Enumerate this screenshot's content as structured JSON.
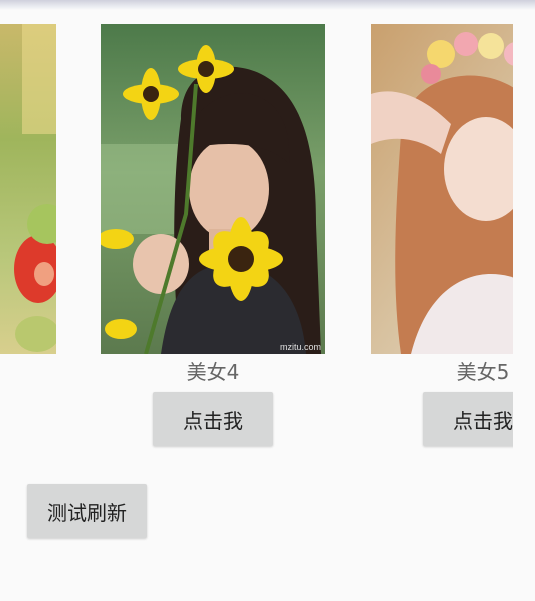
{
  "carousel": {
    "items": [
      {
        "caption": "",
        "button_label": ""
      },
      {
        "caption": "美女4",
        "button_label": "点击我"
      },
      {
        "caption": "美女5",
        "button_label": "点击我"
      }
    ]
  },
  "photo_watermark": "mzitu.com",
  "refresh_button": {
    "label": "测试刷新"
  }
}
